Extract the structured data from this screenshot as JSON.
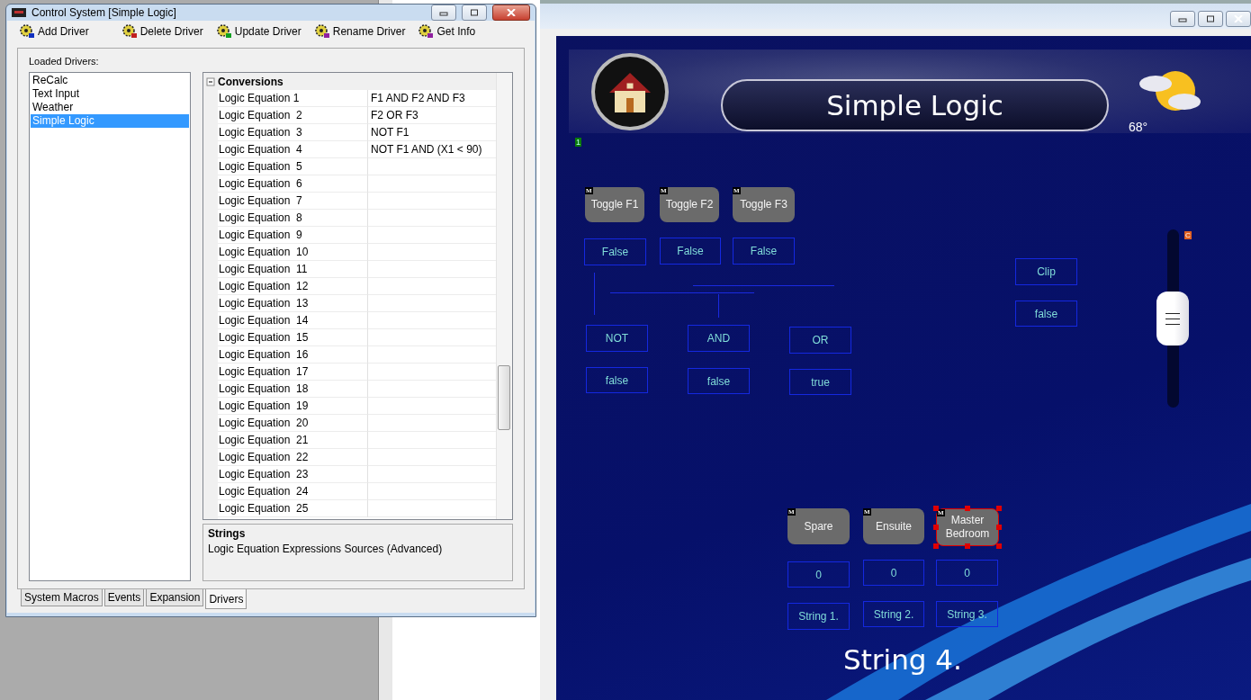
{
  "control_window": {
    "title": "Control System [Simple Logic]",
    "toolbar": [
      {
        "label": "Add Driver",
        "kind": "add"
      },
      {
        "label": "Delete Driver",
        "kind": "delete"
      },
      {
        "label": "Update Driver",
        "kind": "update"
      },
      {
        "label": "Rename Driver",
        "kind": "rename"
      },
      {
        "label": "Get Info",
        "kind": "info"
      }
    ],
    "list_label": "Loaded Drivers:",
    "drivers": [
      {
        "label": "ReCalc",
        "selected": false
      },
      {
        "label": "Text Input",
        "selected": false
      },
      {
        "label": "Weather",
        "selected": false
      },
      {
        "label": "Simple Logic",
        "selected": true
      }
    ],
    "grid": {
      "section": "Conversions",
      "expanded": true,
      "rows": [
        {
          "name": "Logic Equation 1",
          "value": "F1 AND F2 AND F3"
        },
        {
          "name": "Logic Equation  2",
          "value": "F2 OR F3"
        },
        {
          "name": "Logic Equation  3",
          "value": "NOT F1"
        },
        {
          "name": "Logic Equation  4",
          "value": "NOT F1 AND (X1 < 90)"
        },
        {
          "name": "Logic Equation  5"
        },
        {
          "name": "Logic Equation  6"
        },
        {
          "name": "Logic Equation  7"
        },
        {
          "name": "Logic Equation  8"
        },
        {
          "name": "Logic Equation  9"
        },
        {
          "name": "Logic Equation  10"
        },
        {
          "name": "Logic Equation  11"
        },
        {
          "name": "Logic Equation  12"
        },
        {
          "name": "Logic Equation  13"
        },
        {
          "name": "Logic Equation  14"
        },
        {
          "name": "Logic Equation  15"
        },
        {
          "name": "Logic Equation  16"
        },
        {
          "name": "Logic Equation  17"
        },
        {
          "name": "Logic Equation  18"
        },
        {
          "name": "Logic Equation  19"
        },
        {
          "name": "Logic Equation  20"
        },
        {
          "name": "Logic Equation  21"
        },
        {
          "name": "Logic Equation  22"
        },
        {
          "name": "Logic Equation  23"
        },
        {
          "name": "Logic Equation  24"
        },
        {
          "name": "Logic Equation  25"
        }
      ]
    },
    "description": {
      "title": "Strings",
      "text": "Logic Equation Expressions Sources (Advanced)"
    },
    "tabs": [
      {
        "label": "System Macros",
        "selected": false
      },
      {
        "label": "Events",
        "selected": false
      },
      {
        "label": "Expansion",
        "selected": false
      },
      {
        "label": "Drivers",
        "selected": true
      }
    ]
  },
  "designer": {
    "header": {
      "title": "Simple Logic",
      "temperature": "68°"
    },
    "page_marker": "1",
    "buttons": [
      {
        "label": "Toggle F1",
        "badge": "M",
        "selected": false
      },
      {
        "label": "Toggle F2",
        "badge": "M",
        "selected": false
      },
      {
        "label": "Toggle F3",
        "badge": "M",
        "selected": false
      },
      {
        "label": "Spare",
        "badge": "M",
        "selected": false
      },
      {
        "label": "Ensuite",
        "badge": "M",
        "selected": false
      },
      {
        "label": "Master Bedroom",
        "badge": "M",
        "selected": true
      }
    ],
    "indicators": [
      "False",
      "False",
      "False",
      "NOT",
      "AND",
      "OR",
      "false",
      "false",
      "true",
      "Clip",
      "false",
      "0",
      "0",
      "0",
      "String 1.",
      "String 2.",
      "String 3."
    ],
    "slider": {
      "marker": "C",
      "level": 0.5
    },
    "big_text": "String 4."
  }
}
